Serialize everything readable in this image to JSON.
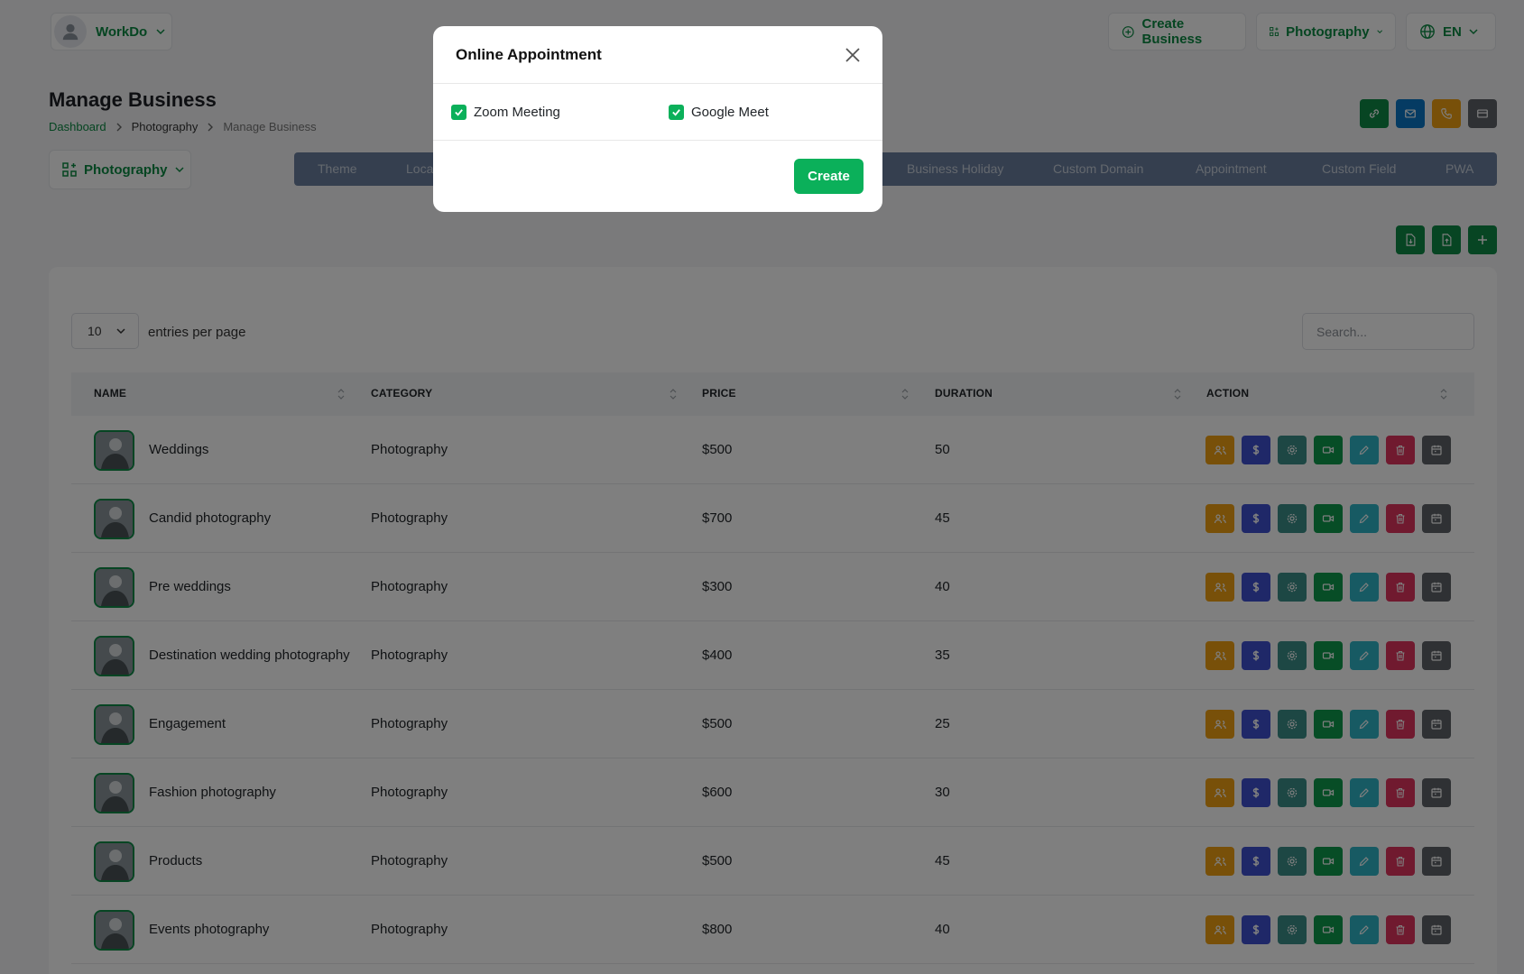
{
  "header": {
    "user_name": "WorkDo",
    "create_business": "Create Business",
    "business_switch": "Photography",
    "language": "EN"
  },
  "page": {
    "title": "Manage Business",
    "breadcrumb": [
      "Dashboard",
      "Photography",
      "Manage Business"
    ]
  },
  "business_select": "Photography",
  "tabs": [
    "Theme",
    "Loca",
    "Business Holiday",
    "Custom Domain",
    "Appointment",
    "Custom Field",
    "PWA"
  ],
  "table": {
    "entries_value": "10",
    "entries_label": "entries per page",
    "search_placeholder": "Search...",
    "headers": [
      "NAME",
      "CATEGORY",
      "PRICE",
      "DURATION",
      "ACTION"
    ],
    "rows": [
      {
        "name": "Weddings",
        "category": "Photography",
        "price": "$500",
        "duration": "50"
      },
      {
        "name": "Candid photography",
        "category": "Photography",
        "price": "$700",
        "duration": "45"
      },
      {
        "name": "Pre weddings",
        "category": "Photography",
        "price": "$300",
        "duration": "40"
      },
      {
        "name": "Destination wedding photography",
        "category": "Photography",
        "price": "$400",
        "duration": "35"
      },
      {
        "name": "Engagement",
        "category": "Photography",
        "price": "$500",
        "duration": "25"
      },
      {
        "name": "Fashion photography",
        "category": "Photography",
        "price": "$600",
        "duration": "30"
      },
      {
        "name": "Products",
        "category": "Photography",
        "price": "$500",
        "duration": "45"
      },
      {
        "name": "Events photography",
        "category": "Photography",
        "price": "$800",
        "duration": "40"
      }
    ],
    "action_icons": [
      "users-icon",
      "dollar-icon",
      "settings-icon",
      "video-icon",
      "edit-icon",
      "trash-icon",
      "calendar-icon"
    ],
    "action_colors": [
      "#f0a012",
      "#3f51d1",
      "#3b8f88",
      "#0e9a4c",
      "#2fb5c7",
      "#e0355f",
      "#5f6368"
    ]
  },
  "modal": {
    "title": "Online Appointment",
    "options": [
      "Zoom Meeting",
      "Google Meet"
    ],
    "create_label": "Create"
  },
  "colors": {
    "brand": "#0b8a43",
    "accent": "#0bb05a"
  }
}
